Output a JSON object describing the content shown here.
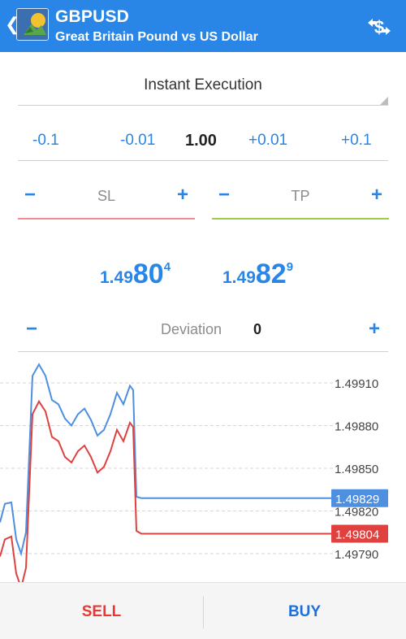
{
  "header": {
    "symbol": "GBPUSD",
    "description": "Great Britain Pound vs US Dollar",
    "back_icon": "chevron-left-icon",
    "trade_icon": "currency-exchange-icon",
    "color": "#2a86e6"
  },
  "order": {
    "execution_type": "Instant Execution",
    "volume": {
      "minus_large": "-0.1",
      "minus_small": "-0.01",
      "value": "1.00",
      "plus_small": "+0.01",
      "plus_large": "+0.1"
    },
    "sl": {
      "label": "SL",
      "minus": "−",
      "plus": "+"
    },
    "tp": {
      "label": "TP",
      "minus": "−",
      "plus": "+"
    },
    "deviation": {
      "label": "Deviation",
      "value": "0",
      "minus": "−",
      "plus": "+"
    }
  },
  "quotes": {
    "bid": {
      "small": "1.49",
      "big": "80",
      "sup": "4"
    },
    "ask": {
      "small": "1.49",
      "big": "82",
      "sup": "9"
    }
  },
  "chart_data": {
    "type": "line",
    "y_ticks": [
      "1.49910",
      "1.49880",
      "1.49850",
      "1.49820",
      "1.49790"
    ],
    "ylim": [
      1.4977,
      1.4993
    ],
    "grid": true,
    "ask_label": "1.49829",
    "bid_label": "1.49804",
    "series": [
      {
        "color": "#4f8fe0",
        "values": [
          1.49812,
          1.49825,
          1.49826,
          1.498,
          1.4979,
          1.49805,
          1.49915,
          1.49923,
          1.49915,
          1.49898,
          1.49895,
          1.49885,
          1.4988,
          1.49888,
          1.49892,
          1.49884,
          1.49873,
          1.49877,
          1.49888,
          1.49903,
          1.49895,
          1.49908,
          1.49905,
          1.4983,
          1.49829,
          1.49829,
          1.49829,
          1.49829,
          1.49829,
          1.49829
        ]
      },
      {
        "color": "#e0413f",
        "values": [
          1.49788,
          1.498,
          1.49802,
          1.49776,
          1.49766,
          1.4978,
          1.49888,
          1.49897,
          1.4989,
          1.49872,
          1.49869,
          1.49858,
          1.49854,
          1.49862,
          1.49866,
          1.49858,
          1.49847,
          1.49851,
          1.49862,
          1.49877,
          1.49869,
          1.49882,
          1.49879,
          1.49806,
          1.49804,
          1.49804,
          1.49804,
          1.49804,
          1.49804,
          1.49804
        ]
      }
    ],
    "ask_color": "#4f8fe0",
    "bid_color": "#e0413f"
  },
  "actions": {
    "sell": "SELL",
    "buy": "BUY",
    "sell_color": "#e53935",
    "buy_color": "#1e6fd9"
  }
}
